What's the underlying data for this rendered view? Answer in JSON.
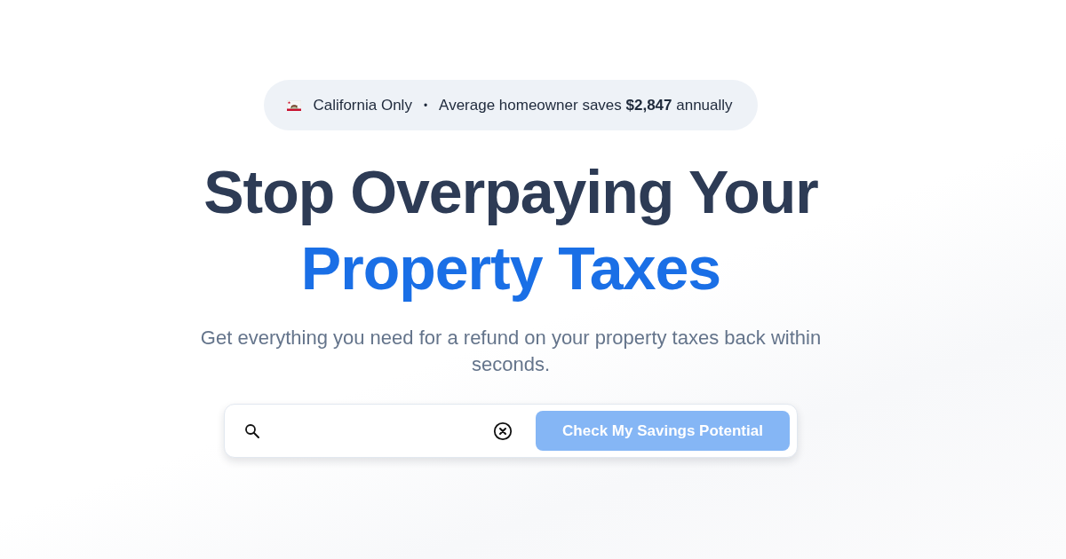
{
  "badge": {
    "region": "California Only",
    "separator": "•",
    "stat": "Average homeowner saves **$2,847** annually"
  },
  "heading": {
    "line_1": "Stop Overpaying Your",
    "line_2": "Property Taxes"
  },
  "subtitle": "Get everything you need for a refund on your property taxes back within seconds.",
  "search": {
    "button": {
      "label": "Check My Savings Potential",
      "disabled": true
    }
  }
}
